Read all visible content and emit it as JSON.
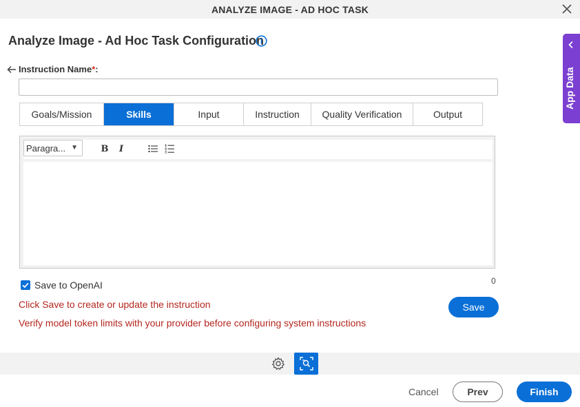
{
  "window": {
    "title": "ANALYZE IMAGE - AD HOC TASK",
    "close_icon": "close-icon"
  },
  "header": {
    "page_title": "Analyze Image - Ad Hoc Task Configuration",
    "info_icon": "info-icon"
  },
  "form": {
    "instruction_name_label": "Instruction Name",
    "required_mark": "*",
    "label_suffix": ":",
    "instruction_name_value": "",
    "instruction_name_placeholder": ""
  },
  "tabs": [
    {
      "label": "Goals/Mission",
      "active": false
    },
    {
      "label": "Skills",
      "active": true
    },
    {
      "label": "Input",
      "active": false
    },
    {
      "label": "Instruction",
      "active": false
    },
    {
      "label": "Quality Verification",
      "active": false
    },
    {
      "label": "Output",
      "active": false
    }
  ],
  "editor": {
    "paragraph_select": "Paragra...",
    "bold_label": "B",
    "italic_label": "I",
    "char_count": "0"
  },
  "options": {
    "save_to_openai_label": "Save to OpenAI",
    "save_to_openai_checked": true
  },
  "messages": {
    "save_hint": "Click Save to create or update the instruction",
    "token_warning": "Verify model token limits with your provider before configuring system instructions"
  },
  "buttons": {
    "save": "Save",
    "cancel": "Cancel",
    "prev": "Prev",
    "finish": "Finish"
  },
  "side_panel": {
    "label": "App Data"
  },
  "colors": {
    "primary": "#0a6fd6",
    "side_panel": "#7b3fd1",
    "error_text": "#b3261e"
  }
}
